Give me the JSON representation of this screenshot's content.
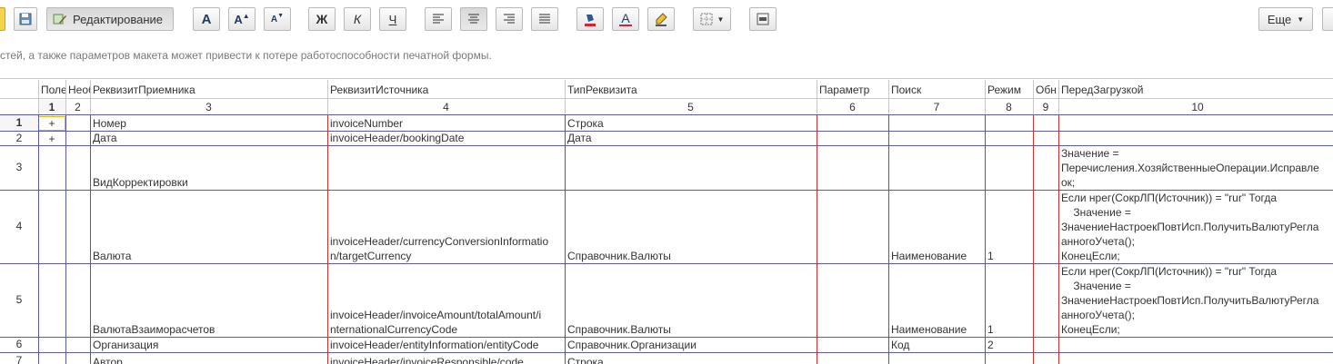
{
  "toolbar": {
    "edit_label": "Редактирование",
    "bold_label": "Ж",
    "italic_label": "К",
    "underline_label": "Ч",
    "more_label": "Еще",
    "font_a": "A",
    "font_up": "A",
    "font_down": "A",
    "fontcolor_a": "A"
  },
  "warning": "стей, а также параметров макета может привести к потере работоспособности печатной формы.",
  "columns": [
    {
      "title": "Поле",
      "num": "1"
    },
    {
      "title": "Необ",
      "num": "2"
    },
    {
      "title": "РеквизитПриемника",
      "num": "3"
    },
    {
      "title": "РеквизитИсточника",
      "num": "4"
    },
    {
      "title": "ТипРеквизита",
      "num": "5"
    },
    {
      "title": "Параметр",
      "num": "6"
    },
    {
      "title": "Поиск",
      "num": "7"
    },
    {
      "title": "Режим",
      "num": "8"
    },
    {
      "title": "Обн",
      "num": "9"
    },
    {
      "title": "ПередЗагрузкой",
      "num": "10"
    }
  ],
  "rows": [
    {
      "num": "1",
      "c1": "+",
      "c3": "Номер",
      "c4": [
        "invoiceNumber"
      ],
      "c5": "Строка",
      "c7": "",
      "c8": "",
      "c10": []
    },
    {
      "num": "2",
      "c1": "+",
      "c3": "Дата",
      "c4": [
        "invoiceHeader/bookingDate"
      ],
      "c5": "Дата",
      "c7": "",
      "c8": "",
      "c10": []
    },
    {
      "num": "3",
      "c1": "",
      "c3": "ВидКорректировки",
      "c4": [],
      "c5": "",
      "c7": "",
      "c8": "",
      "c10": [
        "Значение =",
        "Перечисления.ХозяйственныеОперации.Исправле",
        "ок;"
      ]
    },
    {
      "num": "4",
      "c1": "",
      "c3": "Валюта",
      "c4": [
        "invoiceHeader/currencyConversionInformatio",
        "n/targetCurrency"
      ],
      "c5": "Справочник.Валюты",
      "c7": "Наименование",
      "c8": "1",
      "c10": [
        "Если нрег(СокрЛП(Источник)) = \"rur\" Тогда",
        "    Значение =",
        "ЗначениеНастроекПовтИсп.ПолучитьВалютуРегла",
        "анногоУчета();",
        "КонецЕсли;"
      ]
    },
    {
      "num": "5",
      "c1": "",
      "c3": "ВалютаВзаиморасчетов",
      "c4": [
        "invoiceHeader/invoiceAmount/totalAmount/i",
        "nternationalCurrencyCode"
      ],
      "c5": "Справочник.Валюты",
      "c7": "Наименование",
      "c8": "1",
      "c10": [
        "Если нрег(СокрЛП(Источник)) = \"rur\" Тогда",
        "    Значение =",
        "ЗначениеНастроекПовтИсп.ПолучитьВалютуРегла",
        "анногоУчета();",
        "КонецЕсли;"
      ]
    },
    {
      "num": "6",
      "c1": "",
      "c3": "Организация",
      "c4": [
        "invoiceHeader/entityInformation/entityCode"
      ],
      "c5": "Справочник.Организации",
      "c7": "Код",
      "c8": "2",
      "c10": []
    },
    {
      "num": "7",
      "c1": "",
      "c3": "Автор",
      "c4": [
        "invoiceHeader/invoiceResponsible/code"
      ],
      "c5": "Строка",
      "c7": "",
      "c8": "",
      "c10": []
    }
  ]
}
